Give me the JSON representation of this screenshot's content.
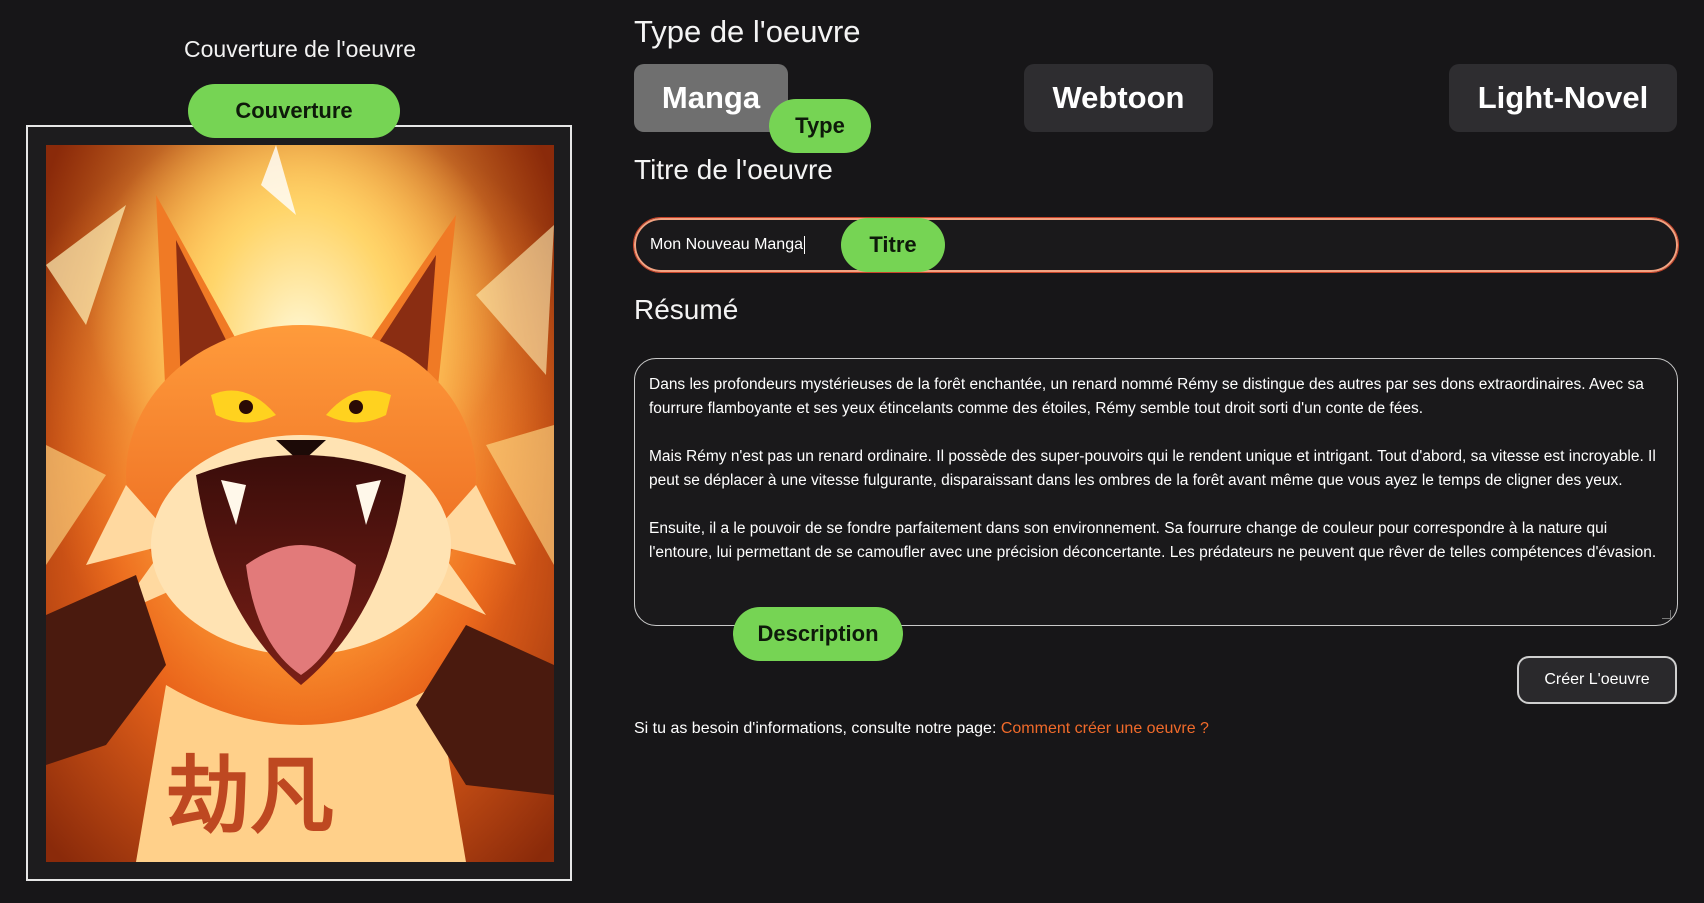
{
  "cover": {
    "heading": "Couverture de l'oeuvre",
    "annotation": "Couverture",
    "image_description": "fox-fire-cover-art"
  },
  "type_section": {
    "heading": "Type de l'oeuvre",
    "options": [
      {
        "label": "Manga",
        "selected": true
      },
      {
        "label": "Webtoon",
        "selected": false
      },
      {
        "label": "Light-Novel",
        "selected": false
      }
    ],
    "annotation": "Type"
  },
  "title_section": {
    "heading": "Titre de l'oeuvre",
    "value": "Mon Nouveau Manga",
    "annotation": "Titre"
  },
  "resume_section": {
    "heading": "Résumé",
    "paragraphs": [
      "Dans les profondeurs mystérieuses de la forêt enchantée, un renard nommé Rémy se distingue des autres par ses dons extraordinaires. Avec sa fourrure flamboyante et ses yeux étincelants comme des étoiles, Rémy semble tout droit sorti d'un conte de fées.",
      "Mais Rémy n'est pas un renard ordinaire. Il possède des super-pouvoirs qui le rendent unique et intrigant. Tout d'abord, sa vitesse est incroyable. Il peut se déplacer à une vitesse fulgurante, disparaissant dans les ombres de la forêt avant même que vous ayez le temps de cligner des yeux.",
      "Ensuite, il a le pouvoir de se fondre parfaitement dans son environnement. Sa fourrure change de couleur pour correspondre à la nature qui l'entoure, lui permettant de se camoufler avec une précision déconcertante. Les prédateurs ne peuvent que rêver de telles compétences d'évasion."
    ],
    "annotation": "Description"
  },
  "actions": {
    "create_label": "Créer L'oeuvre"
  },
  "help": {
    "text": "Si tu as besoin d'informations, consulte notre page: ",
    "link_label": "Comment créer une oeuvre ?"
  },
  "colors": {
    "background": "#171618",
    "annotation_green": "#76d454",
    "link_orange": "#f06a2a",
    "selected_type": "#6f6f6f",
    "unselected_type": "#2e2d30"
  }
}
